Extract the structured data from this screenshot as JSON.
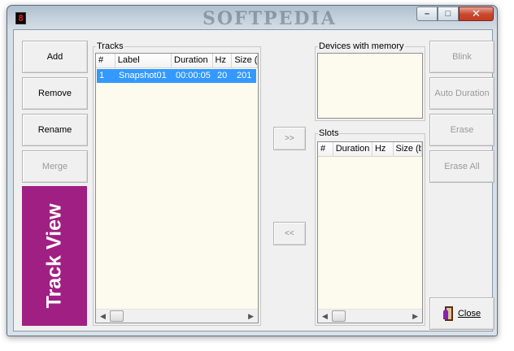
{
  "window": {
    "watermark": "SOFTPEDIA",
    "app_icon_glyph": "8",
    "caption": {
      "minimize": "–",
      "maximize": "□",
      "close": "✕"
    }
  },
  "left_buttons": {
    "add": "Add",
    "remove": "Remove",
    "rename": "Rename",
    "merge": "Merge"
  },
  "track_view_label": "Track View",
  "tracks": {
    "label": "Tracks",
    "columns": [
      "#",
      "Label",
      "Duration",
      "Hz",
      "Size ("
    ],
    "rows": [
      {
        "num": "1",
        "label": "Snapshot01",
        "duration": "00:00:05",
        "hz": "20",
        "size": "201"
      }
    ]
  },
  "transfer": {
    "to_device": ">>",
    "from_device": "<<"
  },
  "devices": {
    "label": "Devices with memory"
  },
  "slots": {
    "label": "Slots",
    "columns": [
      "#",
      "Duration",
      "Hz",
      "Size (b"
    ]
  },
  "right_buttons": {
    "blink": "Blink",
    "auto_duration": "Auto Duration",
    "erase": "Erase",
    "erase_all": "Erase All"
  },
  "close_button": "Close",
  "colors": {
    "accent": "#a01f83",
    "selection": "#3399ff",
    "list_bg": "#fdfaee"
  }
}
